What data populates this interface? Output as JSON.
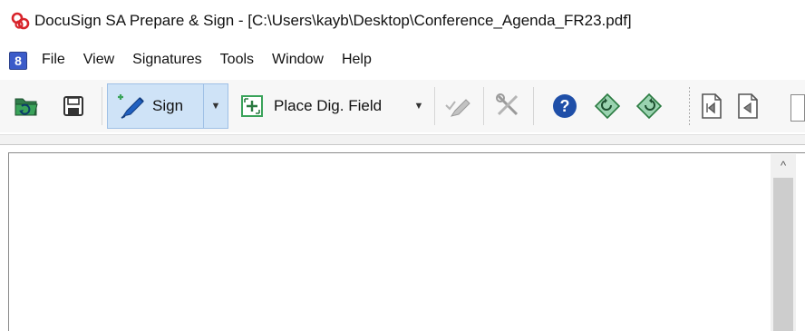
{
  "window": {
    "title": "DocuSign SA Prepare & Sign - [C:\\Users\\kayb\\Desktop\\Conference_Agenda_FR23.pdf]",
    "app_icon": "docusign-logo-icon"
  },
  "menu": {
    "app_icon": "docusign-menu-logo-icon",
    "app_icon_glyph": "8",
    "items": [
      {
        "label": "File"
      },
      {
        "label": "View"
      },
      {
        "label": "Signatures"
      },
      {
        "label": "Tools"
      },
      {
        "label": "Window"
      },
      {
        "label": "Help"
      }
    ]
  },
  "toolbar": {
    "open_icon": "open-folder-icon",
    "save_icon": "save-icon",
    "sign_label": "Sign",
    "place_field_label": "Place Dig. Field",
    "colors": {
      "sign_group_bg": "#cfe3f7",
      "help_circle": "#1f4fa8",
      "green_accent": "#3aa35a",
      "pen_blue": "#2060c0"
    }
  },
  "viewer": {
    "scroll_up_glyph": "^"
  }
}
